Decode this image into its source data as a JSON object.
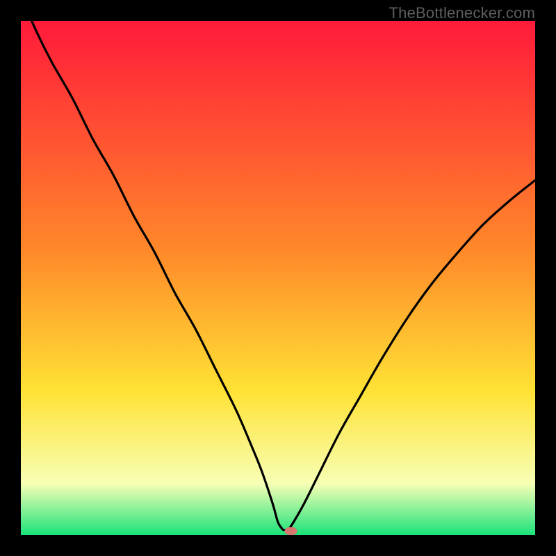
{
  "watermark": "TheBottlenecker.com",
  "colors": {
    "top": "#ff1a3a",
    "orange": "#ff8a2a",
    "yellow": "#ffe235",
    "pale": "#f7ffb5",
    "green": "#19e27a",
    "bg": "#000000",
    "curve": "#000000",
    "marker": "#d6766f"
  },
  "chart_data": {
    "type": "line",
    "title": "",
    "xlabel": "",
    "ylabel": "",
    "xlim": [
      0,
      100
    ],
    "ylim": [
      0,
      100
    ],
    "notch_x": 51,
    "marker": {
      "x": 52.5,
      "y": 0.8
    },
    "series": [
      {
        "name": "bottleneck-curve",
        "x": [
          0,
          3,
          6,
          10,
          14,
          18,
          22,
          26,
          30,
          34,
          38,
          42,
          45,
          47,
          49,
          50,
          51,
          52,
          53,
          55,
          58,
          62,
          66,
          70,
          75,
          80,
          85,
          90,
          95,
          100
        ],
        "y": [
          105,
          98,
          92,
          85,
          77,
          70,
          62,
          55,
          47,
          40,
          32,
          24,
          17,
          12,
          6,
          2.5,
          1,
          1,
          2.5,
          6,
          12,
          20,
          27,
          34,
          42,
          49,
          55,
          60.5,
          65,
          69
        ]
      }
    ]
  }
}
